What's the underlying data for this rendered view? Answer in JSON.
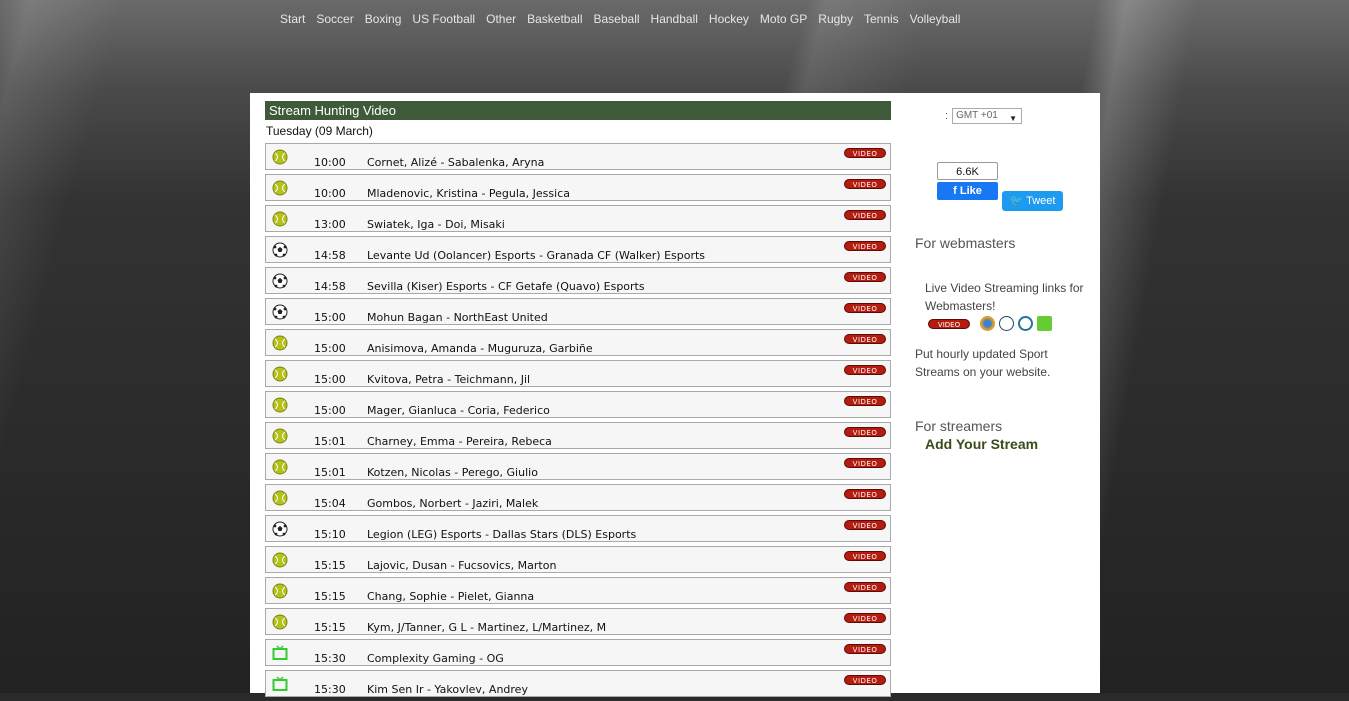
{
  "nav": [
    "Start",
    "Soccer",
    "Boxing",
    "US Football",
    "Other",
    "Basketball",
    "Baseball",
    "Handball",
    "Hockey",
    "Moto GP",
    "Rugby",
    "Tennis",
    "Volleyball"
  ],
  "section_title": "Stream Hunting Video",
  "date": "Tuesday (09 March)",
  "video_label": "VIDEO",
  "rows": [
    {
      "sport": "tennis",
      "time": "10:00",
      "match": "Cornet, Alizé - Sabalenka, Aryna"
    },
    {
      "sport": "tennis",
      "time": "10:00",
      "match": "Mladenovic, Kristina - Pegula, Jessica"
    },
    {
      "sport": "tennis",
      "time": "13:00",
      "match": "Swiatek, Iga - Doi, Misaki"
    },
    {
      "sport": "soccer",
      "time": "14:58",
      "match": "Levante Ud (Oolancer) Esports - Granada CF (Walker) Esports"
    },
    {
      "sport": "soccer",
      "time": "14:58",
      "match": "Sevilla (Kiser) Esports - CF Getafe (Quavo) Esports"
    },
    {
      "sport": "soccer",
      "time": "15:00",
      "match": "Mohun Bagan - NorthEast United"
    },
    {
      "sport": "tennis",
      "time": "15:00",
      "match": "Anisimova, Amanda - Muguruza, Garbiñe"
    },
    {
      "sport": "tennis",
      "time": "15:00",
      "match": "Kvitova, Petra - Teichmann, Jil"
    },
    {
      "sport": "tennis",
      "time": "15:00",
      "match": "Mager, Gianluca - Coria, Federico"
    },
    {
      "sport": "tennis",
      "time": "15:01",
      "match": "Charney, Emma - Pereira, Rebeca"
    },
    {
      "sport": "tennis",
      "time": "15:01",
      "match": "Kotzen, Nicolas - Perego, Giulio"
    },
    {
      "sport": "tennis",
      "time": "15:04",
      "match": "Gombos, Norbert - Jaziri, Malek"
    },
    {
      "sport": "soccer",
      "time": "15:10",
      "match": "Legion (LEG) Esports - Dallas Stars (DLS) Esports"
    },
    {
      "sport": "tennis",
      "time": "15:15",
      "match": "Lajovic, Dusan - Fucsovics, Marton"
    },
    {
      "sport": "tennis",
      "time": "15:15",
      "match": "Chang, Sophie - Pielet, Gianna"
    },
    {
      "sport": "tennis",
      "time": "15:15",
      "match": "Kym, J/Tanner, G L - Martinez, L/Martinez, M"
    },
    {
      "sport": "tv",
      "time": "15:30",
      "match": "Complexity Gaming - OG"
    },
    {
      "sport": "tv",
      "time": "15:30",
      "match": "Kim Sen Ir - Yakovlev, Andrey"
    }
  ],
  "sidebar": {
    "tz_prefix": ":",
    "timezone": "GMT +01",
    "fb_count": "6.6K",
    "fb_like": "Like",
    "tweet": "Tweet",
    "webmasters_heading": "For webmasters",
    "webmasters_text": "Live Video Streaming links for Webmasters!",
    "put_text": "Put hourly updated Sport Streams on your website.",
    "streamers_heading": "For streamers",
    "add_stream": "Add Your Stream"
  },
  "colors": {
    "title_bar": "#3e5a38",
    "video_button": "#b41c10",
    "tennis_ball": "#b5c21a",
    "tv_icon": "#33cc33"
  }
}
